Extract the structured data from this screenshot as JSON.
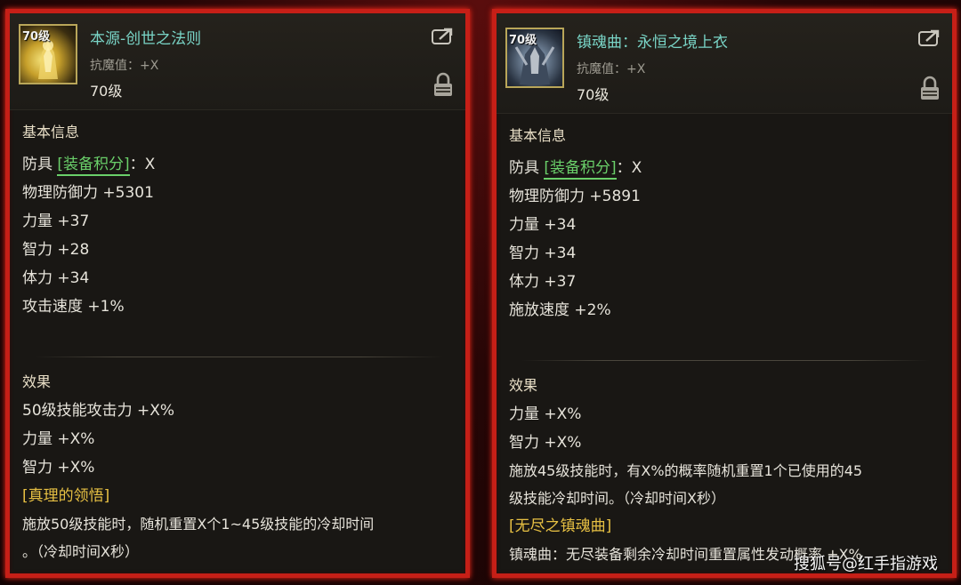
{
  "watermark": "搜狐号@红手指游戏",
  "colors": {
    "border": "#c61f17",
    "name": "#79d4c6",
    "tag": "#6ad06a",
    "gold": "#e7c043"
  },
  "left": {
    "avatar_level": "70级",
    "name": "本源-创世之法则",
    "magic_resist": "抗魔值：+X",
    "level": "70级",
    "basic_title": "基本信息",
    "armor_prefix": "防具",
    "armor_tag": "[装备积分]",
    "armor_suffix": "：X",
    "stats": [
      "物理防御力 +5301",
      "力量 +37",
      "智力 +28",
      "体力 +34",
      "攻击速度 +1%"
    ],
    "effect_title": "效果",
    "effects": [
      "50级技能攻击力 +X%",
      "力量 +X%",
      "智力 +X%"
    ],
    "special_title": "[真理的领悟]",
    "special_desc_1": "施放50级技能时，随机重置X个1~45级技能的冷却时间",
    "special_desc_2": "。（冷却时间X秒）"
  },
  "right": {
    "avatar_level": "70级",
    "name": "镇魂曲：永恒之境上衣",
    "magic_resist": "抗魔值：+X",
    "level": "70级",
    "basic_title": "基本信息",
    "armor_prefix": "防具",
    "armor_tag": "[装备积分]",
    "armor_suffix": "：X",
    "stats": [
      "物理防御力 +5891",
      "力量 +34",
      "智力 +34",
      "体力 +37",
      "施放速度 +2%"
    ],
    "effect_title": "效果",
    "effects": [
      "力量 +X%",
      "智力 +X%"
    ],
    "effect_desc_1": "施放45级技能时，有X%的概率随机重置1个已使用的45",
    "effect_desc_2": "级技能冷却时间。（冷却时间X秒）",
    "special_title": "[无尽之镇魂曲]",
    "special_desc": "镇魂曲：无尽装备剩余冷却时间重置属性发动概率 +X%"
  }
}
